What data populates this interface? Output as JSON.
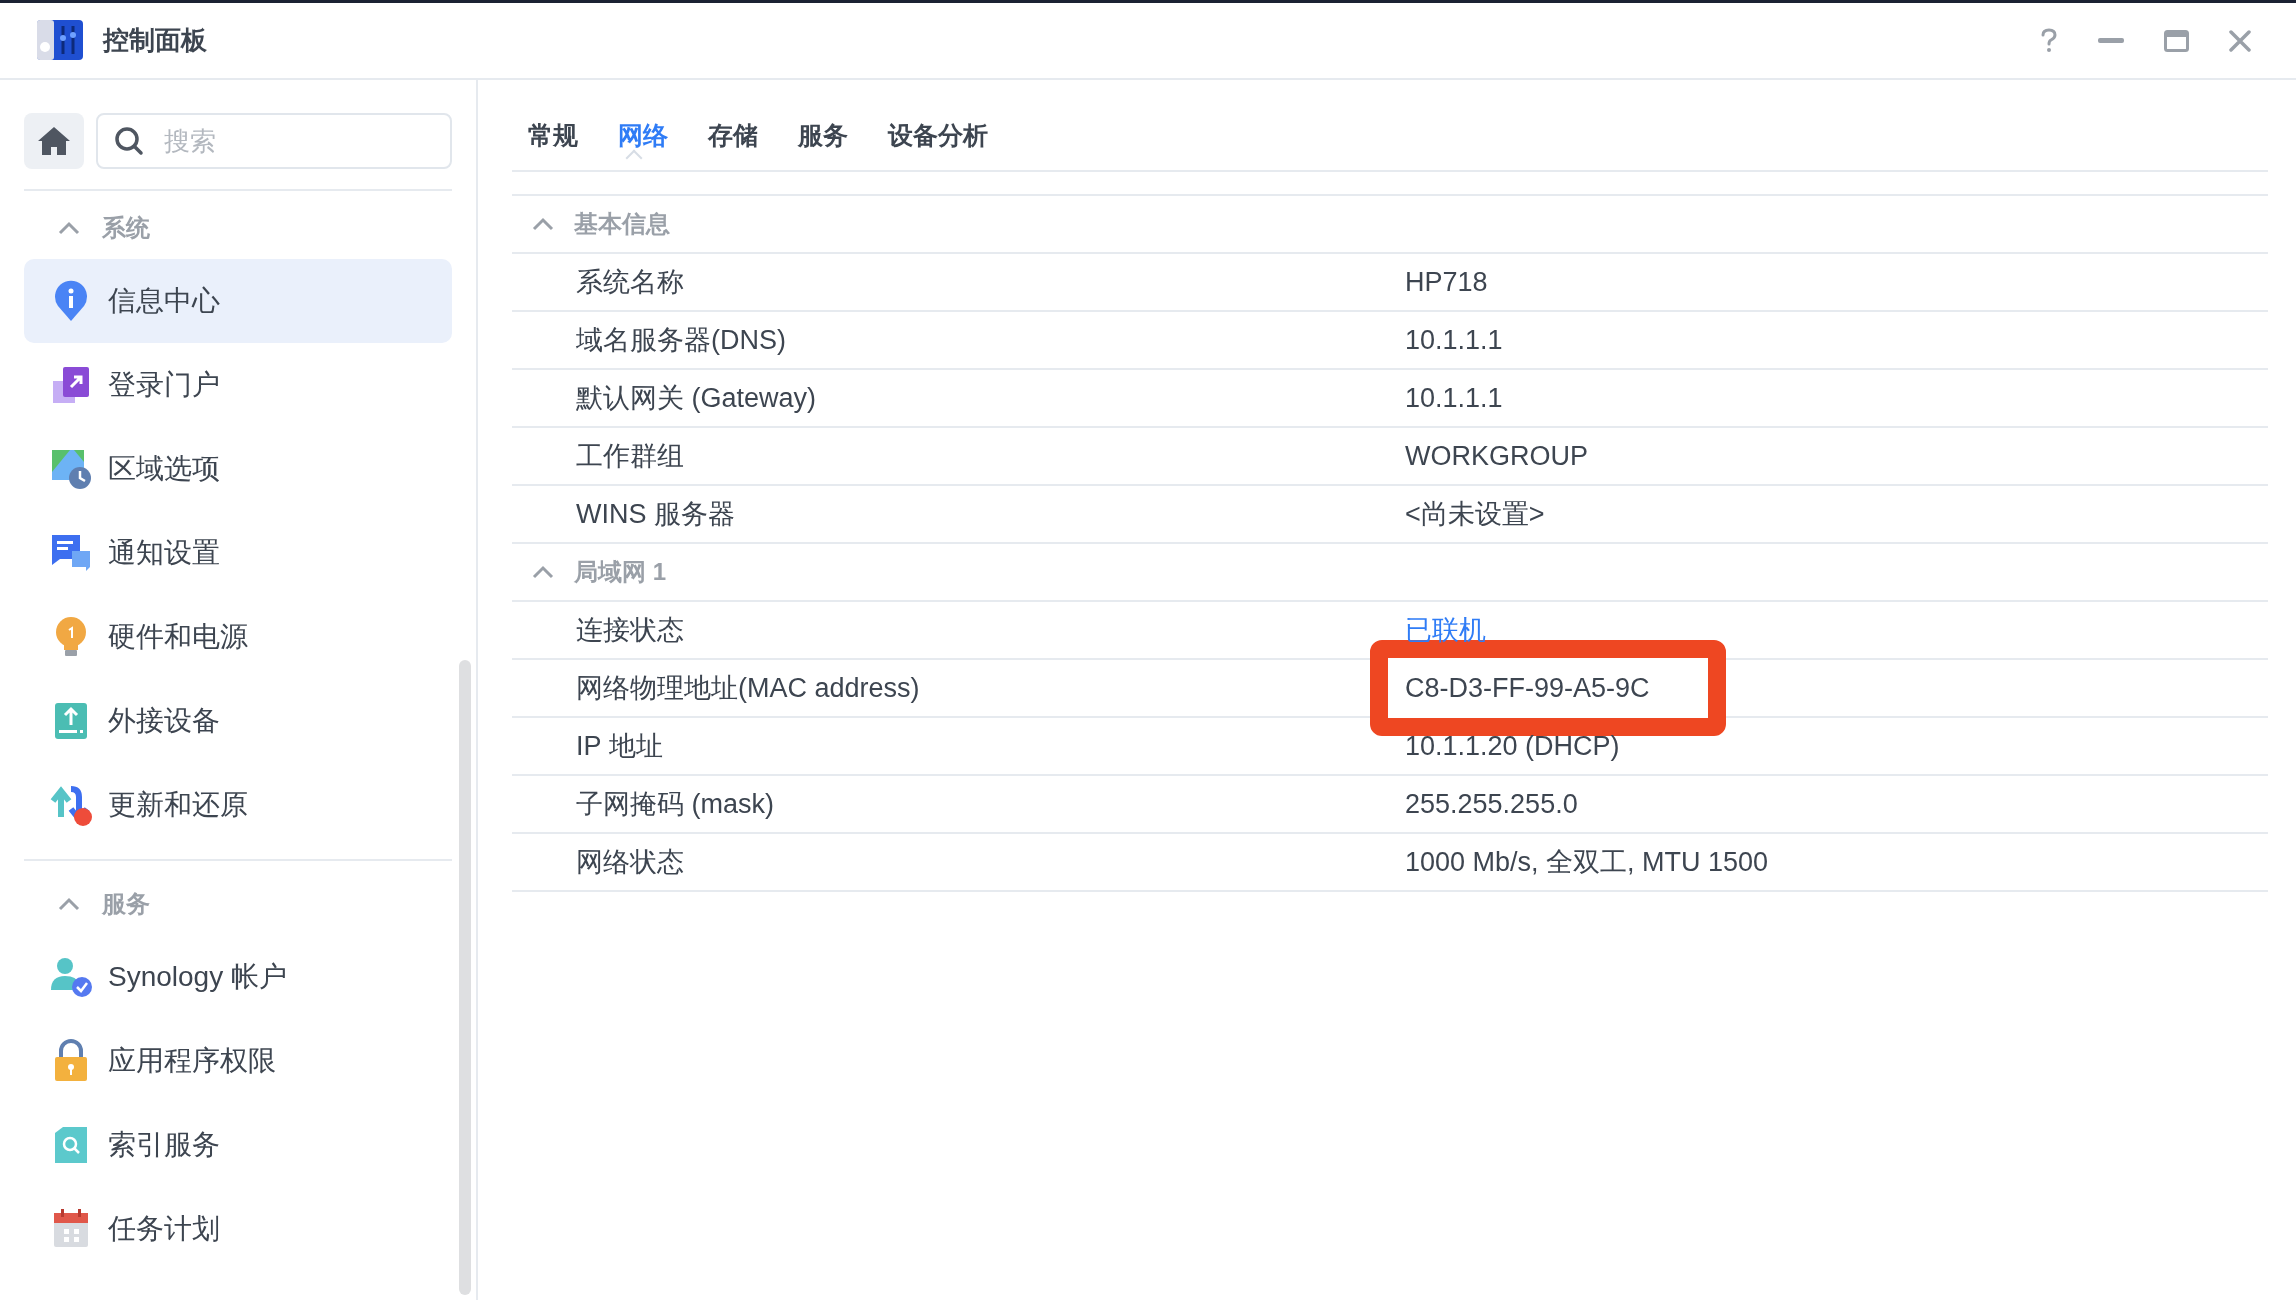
{
  "window": {
    "title": "控制面板"
  },
  "search": {
    "placeholder": "搜索"
  },
  "sidebar": {
    "groups": [
      {
        "title": "系统",
        "expanded": true,
        "items": [
          {
            "label": "信息中心",
            "selected": true
          },
          {
            "label": "登录门户",
            "selected": false
          },
          {
            "label": "区域选项",
            "selected": false
          },
          {
            "label": "通知设置",
            "selected": false
          },
          {
            "label": "硬件和电源",
            "selected": false
          },
          {
            "label": "外接设备",
            "selected": false
          },
          {
            "label": "更新和还原",
            "selected": false
          }
        ]
      },
      {
        "title": "服务",
        "expanded": true,
        "items": [
          {
            "label": "Synology 帐户",
            "selected": false
          },
          {
            "label": "应用程序权限",
            "selected": false
          },
          {
            "label": "索引服务",
            "selected": false
          },
          {
            "label": "任务计划",
            "selected": false
          }
        ]
      }
    ]
  },
  "tabs": [
    {
      "label": "常规",
      "selected": false
    },
    {
      "label": "网络",
      "selected": true
    },
    {
      "label": "存储",
      "selected": false
    },
    {
      "label": "服务",
      "selected": false
    },
    {
      "label": "设备分析",
      "selected": false
    }
  ],
  "sections": [
    {
      "title": "基本信息",
      "expanded": true,
      "rows": [
        {
          "label": "系统名称",
          "value": "HP718",
          "link": false,
          "highlighted": false
        },
        {
          "label": "域名服务器(DNS)",
          "value": "10.1.1.1",
          "link": false,
          "highlighted": false
        },
        {
          "label": "默认网关 (Gateway)",
          "value": "10.1.1.1",
          "link": false,
          "highlighted": false
        },
        {
          "label": "工作群组",
          "value": "WORKGROUP",
          "link": false,
          "highlighted": false
        },
        {
          "label": "WINS 服务器",
          "value": "<尚未设置>",
          "link": false,
          "highlighted": false
        }
      ]
    },
    {
      "title": "局域网 1",
      "expanded": true,
      "rows": [
        {
          "label": "连接状态",
          "value": "已联机",
          "link": true,
          "highlighted": false
        },
        {
          "label": "网络物理地址(MAC address)",
          "value": "C8-D3-FF-99-A5-9C",
          "link": false,
          "highlighted": true
        },
        {
          "label": "IP 地址",
          "value": "10.1.1.20 (DHCP)",
          "link": false,
          "highlighted": false
        },
        {
          "label": "子网掩码 (mask)",
          "value": "255.255.255.0",
          "link": false,
          "highlighted": false
        },
        {
          "label": "网络状态",
          "value": "1000 Mb/s, 全双工, MTU 1500",
          "link": false,
          "highlighted": false
        }
      ]
    }
  ]
}
